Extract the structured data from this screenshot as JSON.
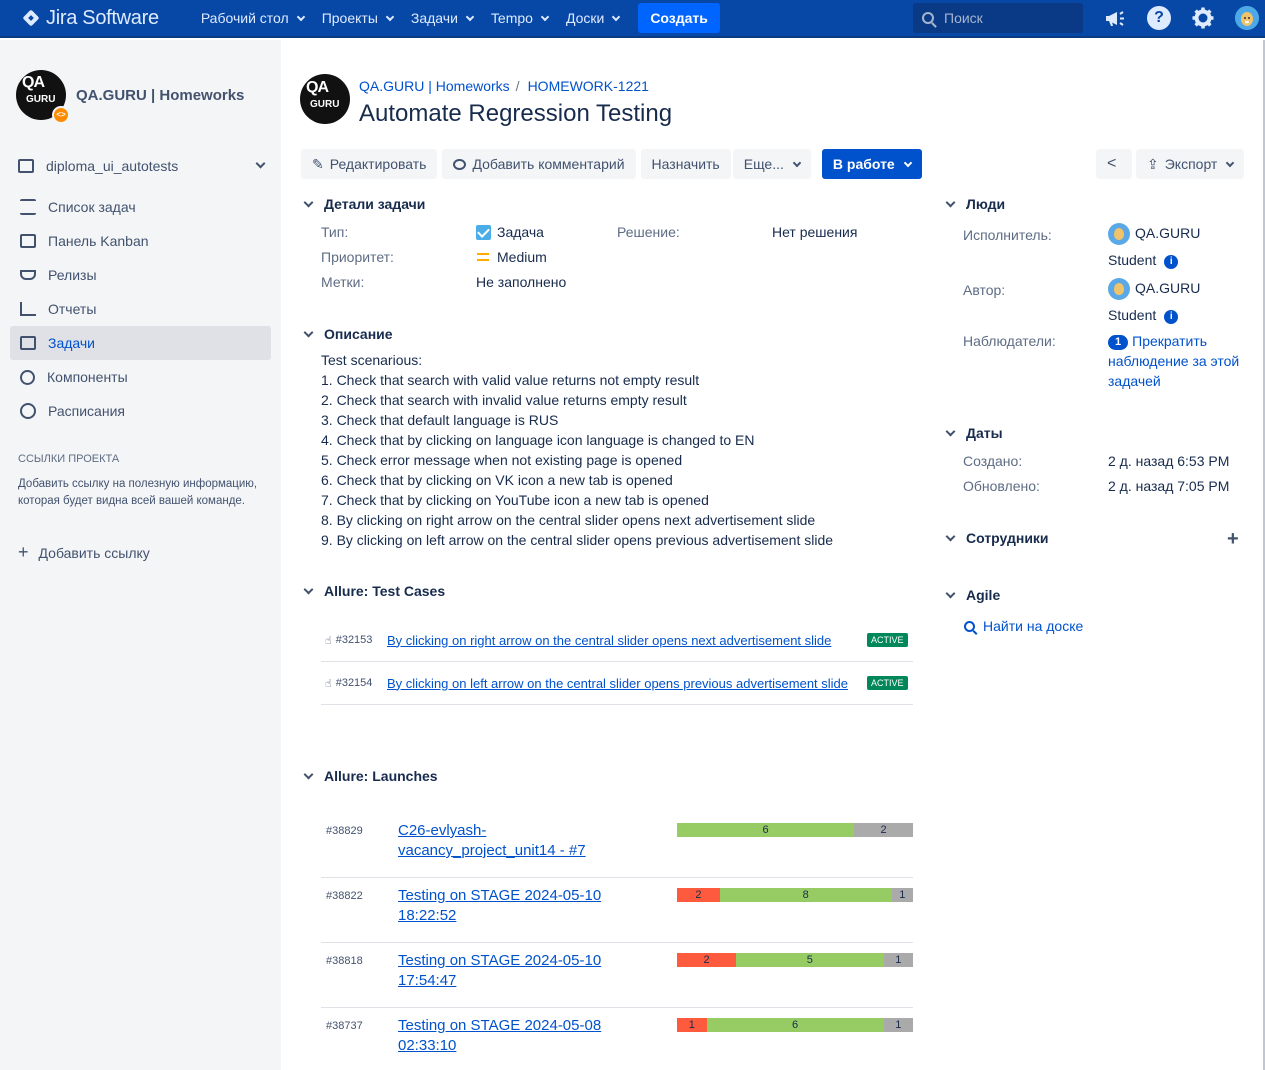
{
  "topbar": {
    "logo": "Jira Software",
    "nav": [
      "Рабочий стол",
      "Проекты",
      "Задачи",
      "Tempo",
      "Доски"
    ],
    "create": "Создать",
    "search_placeholder": "Поиск"
  },
  "sidebar": {
    "project_name": "QA.GURU | Homeworks",
    "avatar_text_top": "QA",
    "avatar_text_bottom": "GURU",
    "board": "diploma_ui_autotests",
    "items": [
      {
        "label": "Список задач",
        "icon": "backlog-icon"
      },
      {
        "label": "Панель Kanban",
        "icon": "board-icon"
      },
      {
        "label": "Релизы",
        "icon": "ship-icon"
      },
      {
        "label": "Отчеты",
        "icon": "chart-icon"
      },
      {
        "label": "Задачи",
        "icon": "issues-icon",
        "active": true
      },
      {
        "label": "Компоненты",
        "icon": "puzzle-icon"
      },
      {
        "label": "Расписания",
        "icon": "clock-icon"
      }
    ],
    "links_title": "ССЫЛКИ ПРОЕКТА",
    "links_hint": "Добавить ссылку на полезную информацию, которая будет видна всей вашей команде.",
    "add_link": "Добавить ссылку"
  },
  "issue": {
    "breadcrumb_project": "QA.GURU | Homeworks",
    "breadcrumb_key": "HOMEWORK-1221",
    "title": "Automate Regression Testing"
  },
  "toolbar": {
    "edit": "Редактировать",
    "comment": "Добавить комментарий",
    "assign": "Назначить",
    "more": "Еще...",
    "status": "В работе",
    "export": "Экспорт"
  },
  "details": {
    "section": "Детали задачи",
    "type_label": "Тип:",
    "type_value": "Задача",
    "priority_label": "Приоритет:",
    "priority_value": "Medium",
    "labels_label": "Метки:",
    "labels_value": "Не заполнено",
    "resolution_label": "Решение:",
    "resolution_value": "Нет решения"
  },
  "description": {
    "section": "Описание",
    "lines": [
      "Test scenarious:",
      "1. Check that search with valid value returns not empty result",
      "2. Check that search with invalid value returns empty result",
      "3. Check that default language is RUS",
      "4. Check that by clicking on language icon language is changed to EN",
      "5. Check error message when not existing page is opened",
      "6. Check that by clicking on VK icon a new tab is opened",
      "7. Check that by clicking on YouTube icon a new tab is opened",
      "8. By clicking on right arrow on the central slider opens next advertisement slide",
      "9. By clicking on left arrow on the central slider opens previous advertisement slide"
    ]
  },
  "test_cases": {
    "section": "Allure: Test Cases",
    "rows": [
      {
        "id": "#32153",
        "name": "By clicking on right arrow on the central slider opens next advertisement slide",
        "status": "ACTIVE"
      },
      {
        "id": "#32154",
        "name": "By clicking on left arrow on the central slider opens previous advertisement slide",
        "status": "ACTIVE"
      }
    ]
  },
  "launches": {
    "section": "Allure: Launches",
    "rows": [
      {
        "id": "#38829",
        "name": "C26-evlyash-vacancy_project_unit14 - #7",
        "failed": 0,
        "passed": 6,
        "skipped": 2
      },
      {
        "id": "#38822",
        "name": "Testing on STAGE 2024-05-10 18:22:52",
        "failed": 2,
        "passed": 8,
        "skipped": 1
      },
      {
        "id": "#38818",
        "name": "Testing on STAGE 2024-05-10 17:54:47",
        "failed": 2,
        "passed": 5,
        "skipped": 1
      },
      {
        "id": "#38737",
        "name": "Testing on STAGE 2024-05-08 02:33:10",
        "failed": 1,
        "passed": 6,
        "skipped": 1
      }
    ]
  },
  "people": {
    "section": "Люди",
    "assignee_label": "Исполнитель:",
    "assignee_name": "QA.GURU",
    "assignee_name2": "Student",
    "author_label": "Автор:",
    "author_name": "QA.GURU",
    "author_name2": "Student",
    "watchers_label": "Наблюдатели:",
    "watchers_count": "1",
    "watchers_action": "Прекратить наблюдение за этой задачей"
  },
  "dates": {
    "section": "Даты",
    "created_label": "Создано:",
    "created_value": "2 д. назад 6:53 PM",
    "updated_label": "Обновлено:",
    "updated_value": "2 д. назад 7:05 PM"
  },
  "staff": {
    "section": "Сотрудники"
  },
  "agile": {
    "section": "Agile",
    "link": "Найти на доске"
  },
  "colors": {
    "brand": "#0747a6",
    "primary": "#0052cc",
    "failed": "#fd5a3e",
    "passed": "#97cc64",
    "skipped": "#aaaaaa"
  }
}
